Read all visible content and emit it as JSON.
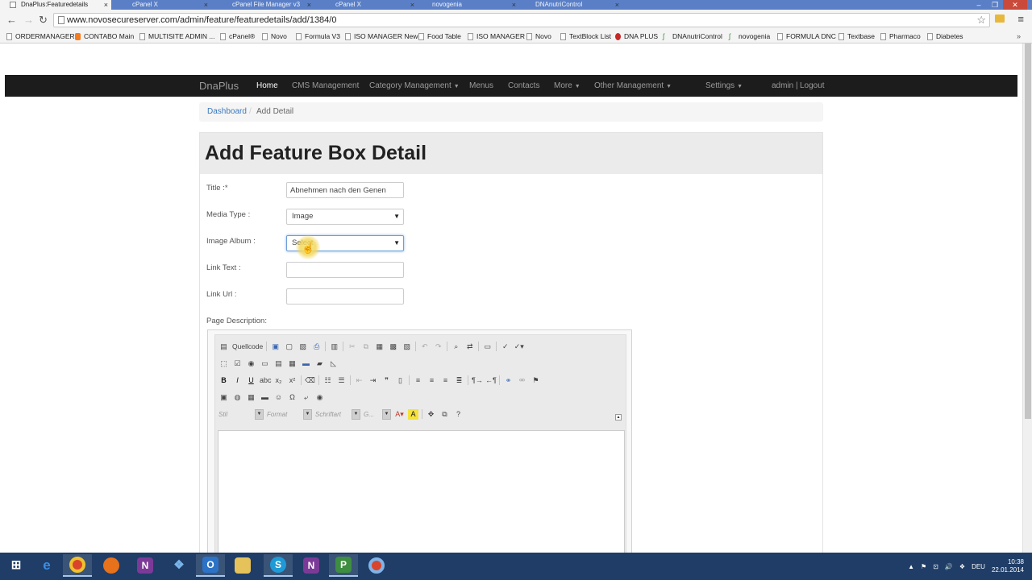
{
  "browser": {
    "tabs": [
      {
        "title": "DnaPlus:Featuredetails",
        "active": true
      },
      {
        "title": "cPanel X",
        "active": false
      },
      {
        "title": "cPanel File Manager v3",
        "active": false
      },
      {
        "title": "cPanel X",
        "active": false
      },
      {
        "title": "novogenia",
        "active": false
      },
      {
        "title": "DNAnutriControl",
        "active": false
      }
    ],
    "url": "www.novosecureserver.com/admin/feature/featuredetails/add/1384/0",
    "bookmarks": [
      "ORDERMANAGER",
      "CONTABO Main",
      "MULTISITE ADMIN ...",
      "cPanel®",
      "Novo",
      "Formula V3",
      "ISO MANAGER New",
      "Food Table",
      "ISO MANAGER",
      "Novo",
      "TextBlock List",
      "DNA PLUS",
      "DNAnutriControl",
      "novogenia",
      "FORMULA DNC",
      "Textbase",
      "Pharmaco",
      "Diabetes"
    ],
    "bookmarks_more": "»"
  },
  "navbar": {
    "brand": "DnaPlus",
    "items": [
      "Home",
      "CMS Management",
      "Category Management",
      "Menus",
      "Contacts",
      "More",
      "Other Management",
      "Settings"
    ],
    "user": "admin |",
    "logout": "Logout"
  },
  "breadcrumb": {
    "root": "Dashboard",
    "separator": "/",
    "current": "Add Detail"
  },
  "form": {
    "heading": "Add Feature Box Detail",
    "title_label": "Title :*",
    "title_value": "Abnehmen nach den Genen",
    "media_type_label": "Media Type :",
    "media_type_value": "Image",
    "image_album_label": "Image Album :",
    "image_album_value": "Select",
    "link_text_label": "Link Text :",
    "link_url_label": "Link Url :",
    "page_description_label": "Page Description:"
  },
  "editor": {
    "source_label": "Quellcode",
    "combo_style": "Stil",
    "combo_format": "Format",
    "combo_font": "Schriftart",
    "combo_size": "G..."
  },
  "taskbar": {
    "apps": [
      "start",
      "internet-explorer",
      "chrome",
      "firefox",
      "onenote",
      "dropbox",
      "outlook",
      "file-explorer",
      "skype",
      "onenote-2",
      "project",
      "chrome-2"
    ],
    "language": "DEU",
    "time": "10:38",
    "date": "22.01.2014"
  },
  "colors": {
    "navbar_bg": "#1c1c1c",
    "link_blue": "#3a78bc",
    "taskbar_bg": "#1f3d66"
  }
}
